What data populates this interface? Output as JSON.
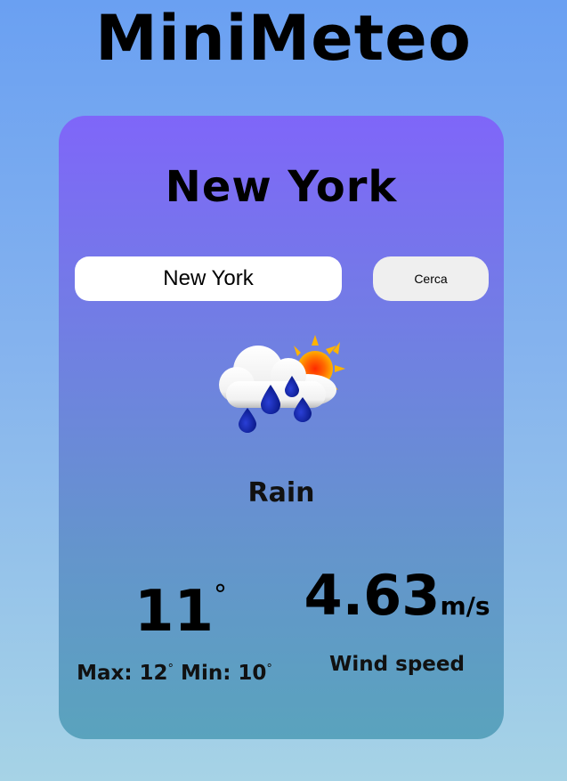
{
  "app": {
    "title": "MiniMeteo"
  },
  "weather": {
    "city": "New York",
    "condition": "Rain",
    "icon": "rain-cloud-sun-icon",
    "temperature": "11",
    "degree_symbol": "°",
    "max_label": "Max: 12",
    "min_label": " Min: 10",
    "wind_speed": "4.63",
    "wind_unit": "m/s",
    "wind_label": "Wind speed"
  },
  "search": {
    "value": "New York",
    "button_label": "Cerca"
  },
  "colors": {
    "page_gradient_top": "#6aa0f2",
    "page_gradient_bottom": "#a6d3e6",
    "card_gradient_top": "#7f66f9",
    "card_gradient_bottom": "#5aa3bd",
    "input_background": "#ffffff",
    "button_background": "#efefef"
  }
}
